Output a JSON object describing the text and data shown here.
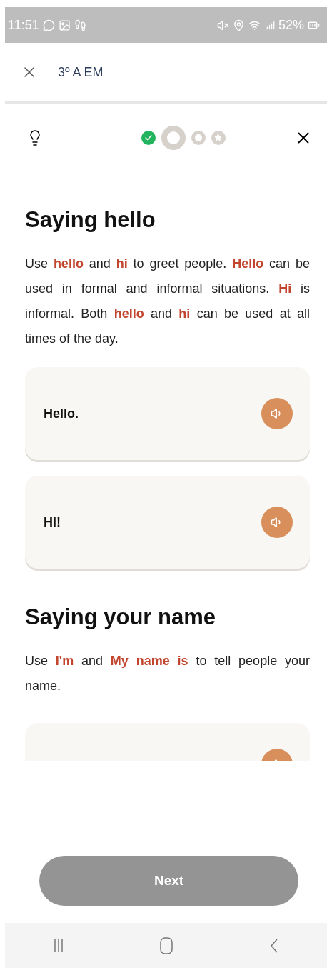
{
  "status_bar": {
    "time": "11:51",
    "battery": "52%"
  },
  "header": {
    "title": "3º A EM"
  },
  "progress": {
    "steps": [
      {
        "kind": "done"
      },
      {
        "kind": "current"
      },
      {
        "kind": "pending"
      },
      {
        "kind": "goal"
      }
    ]
  },
  "sections": [
    {
      "title": "Saying hello",
      "text": "Use **hello** and **hi** to greet people. **Hello** can be used in formal and informal situations. **Hi** is informal. Both **hello** and **hi** can be used at all times of the day.",
      "phrases": [
        {
          "text": "Hello."
        },
        {
          "text": "Hi!"
        }
      ]
    },
    {
      "title": "Saying your name",
      "text": "Use **I'm** and **My name is** to tell people your name.",
      "phrases": [
        {
          "kind": "clipped"
        }
      ]
    }
  ],
  "next_button": {
    "label": "Next",
    "disabled": true
  }
}
